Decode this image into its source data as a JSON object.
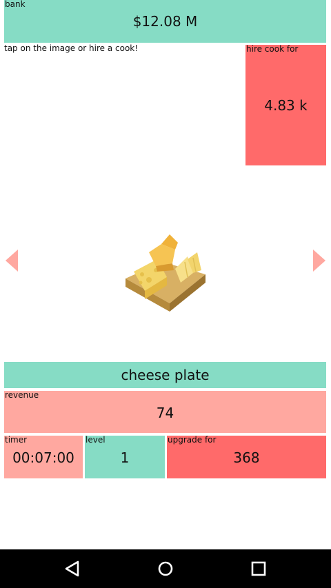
{
  "bank": {
    "caption": "bank",
    "value": "$12.08 M"
  },
  "hint": "tap on the image or hire a cook!",
  "hire": {
    "caption": "hire cook for",
    "value": "4.83 k"
  },
  "dish": {
    "name": "cheese plate",
    "image_icon": "cheese-plate-icon"
  },
  "revenue": {
    "caption": "revenue",
    "value": "74"
  },
  "timer": {
    "caption": "timer",
    "value": "00:07:00"
  },
  "level": {
    "caption": "level",
    "value": "1"
  },
  "upgrade": {
    "caption": "upgrade for",
    "value": "368"
  },
  "colors": {
    "teal": "#86dcc5",
    "salmon": "#ffa8a0",
    "red": "#ff6a6a",
    "navbar": "#000000"
  },
  "navbar": {
    "icons": [
      "back-icon",
      "home-icon",
      "recents-icon"
    ]
  }
}
